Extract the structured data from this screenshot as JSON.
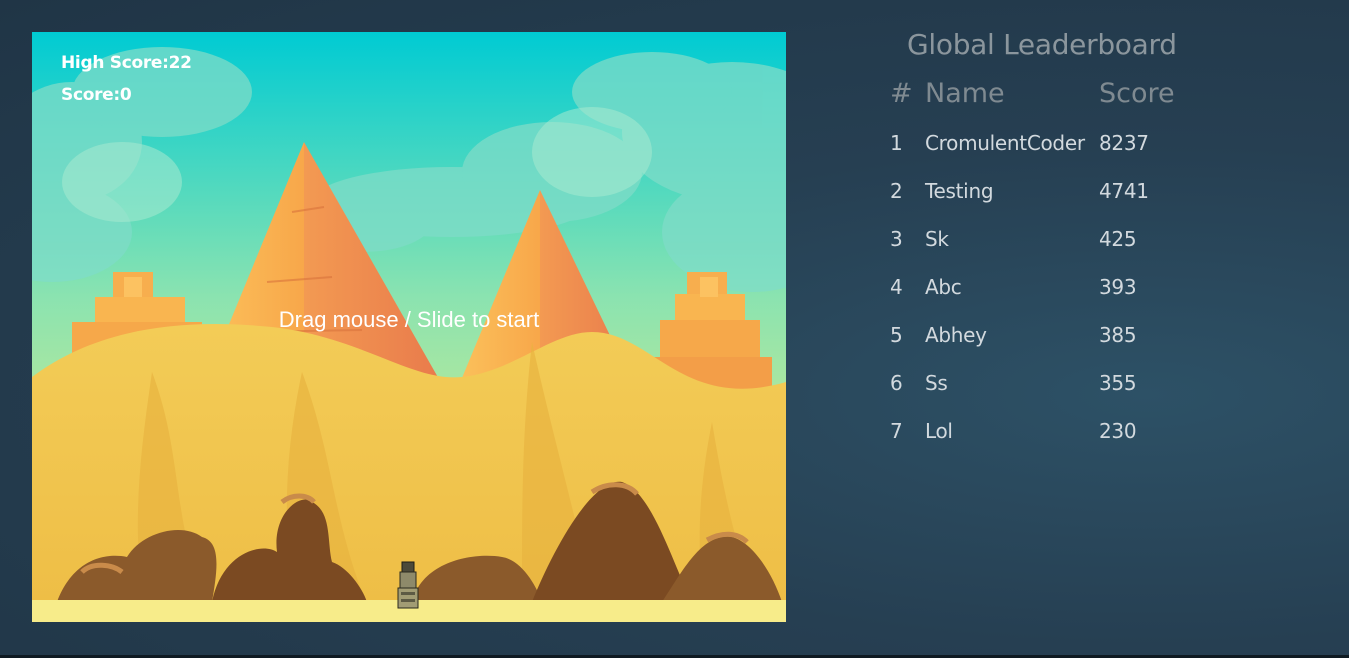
{
  "game": {
    "high_score_label": "High Score:22",
    "score_label": "Score:0",
    "start_message": "Drag mouse / Slide to start"
  },
  "leaderboard": {
    "title": "Global Leaderboard",
    "headers": {
      "rank": "#",
      "name": "Name",
      "score": "Score"
    },
    "rows": [
      {
        "rank": "1",
        "name": "CromulentCoder",
        "score": "8237"
      },
      {
        "rank": "2",
        "name": "Testing",
        "score": "4741"
      },
      {
        "rank": "3",
        "name": "Sk",
        "score": "425"
      },
      {
        "rank": "4",
        "name": "Abc",
        "score": "393"
      },
      {
        "rank": "5",
        "name": "Abhey",
        "score": "385"
      },
      {
        "rank": "6",
        "name": "Ss",
        "score": "355"
      },
      {
        "rank": "7",
        "name": "Lol",
        "score": "230"
      }
    ]
  },
  "colors": {
    "sky_top": "#00cbd3",
    "sand": "#f1c44f",
    "pyramid": "#f7a54a",
    "rock": "#8b5a2b"
  }
}
